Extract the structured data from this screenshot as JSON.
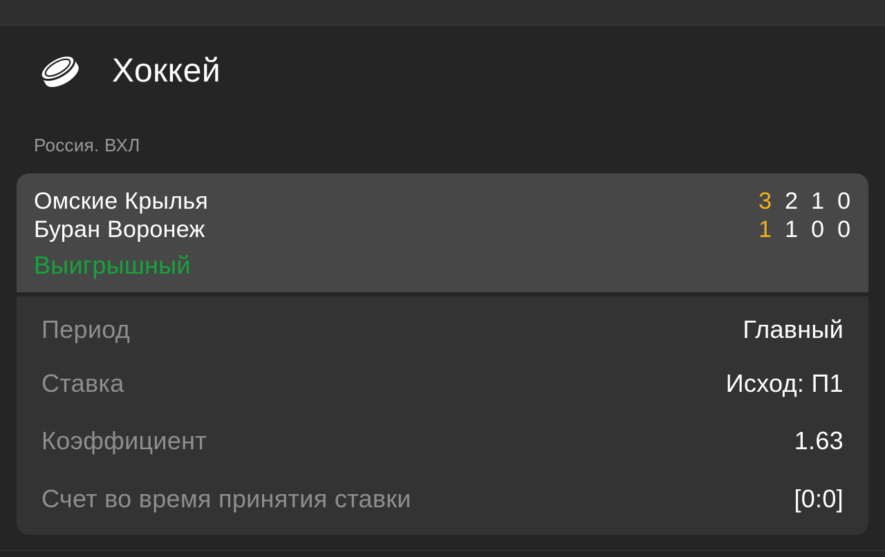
{
  "sport": {
    "title": "Хоккей",
    "icon": "hockey-puck-icon"
  },
  "league": "Россия. ВХЛ",
  "match": {
    "teams": [
      {
        "name": "Омские Крылья",
        "scores": [
          "3",
          "2",
          "1",
          "0"
        ]
      },
      {
        "name": "Буран Воронеж",
        "scores": [
          "1",
          "1",
          "0",
          "0"
        ]
      }
    ],
    "status": "Выигрышный"
  },
  "details": [
    {
      "label": "Период",
      "value": "Главный"
    },
    {
      "label": "Ставка",
      "value": "Исход: П1"
    },
    {
      "label": "Коэффициент",
      "value": "1.63"
    },
    {
      "label": "Счет во время принятия ставки",
      "value": "[0:0]"
    }
  ],
  "colors": {
    "accent_score": "#f2b21a",
    "win_status": "#17a23a",
    "background": "#252525",
    "card": "#333333",
    "card_header": "#474747"
  }
}
